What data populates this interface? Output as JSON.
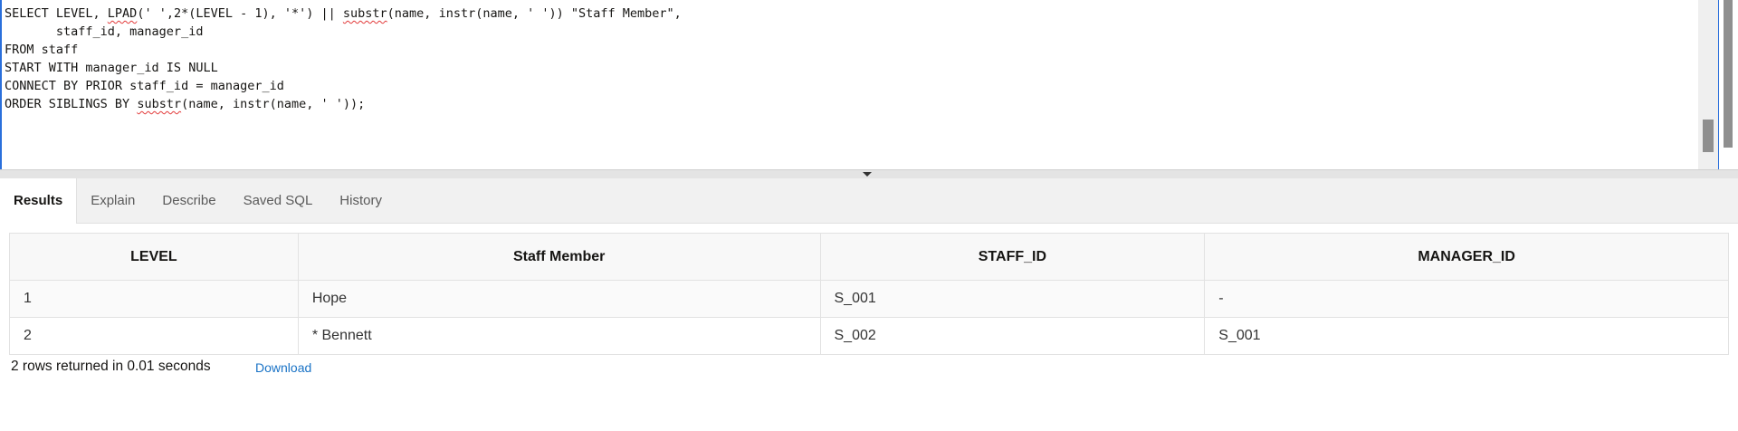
{
  "editor": {
    "lines": [
      [
        "SELECT LEVEL, ",
        {
          "t": "LPAD",
          "err": true
        },
        "(' ',2*(LEVEL - 1), '*') || ",
        {
          "t": "substr",
          "err": true
        },
        "(name, instr(name, ' ')) \"Staff Member\","
      ],
      [
        "       staff_id, manager_id"
      ],
      [
        "FROM staff"
      ],
      [
        "START WITH manager_id IS NULL"
      ],
      [
        "CONNECT BY PRIOR staff_id = manager_id"
      ],
      [
        "ORDER SIBLINGS BY ",
        {
          "t": "substr",
          "err": true
        },
        "(name, instr(name, ' '));"
      ]
    ]
  },
  "tabs": [
    {
      "label": "Results",
      "active": true
    },
    {
      "label": "Explain",
      "active": false
    },
    {
      "label": "Describe",
      "active": false
    },
    {
      "label": "Saved SQL",
      "active": false
    },
    {
      "label": "History",
      "active": false
    }
  ],
  "results": {
    "columns": [
      "LEVEL",
      "Staff Member",
      "STAFF_ID",
      "MANAGER_ID"
    ],
    "rows": [
      [
        "1",
        "Hope",
        "S_001",
        "-"
      ],
      [
        "2",
        "* Bennett",
        "S_002",
        "S_001"
      ]
    ]
  },
  "footer": {
    "status": "2 rows returned in 0.01 seconds",
    "download_label": "Download"
  },
  "colors": {
    "accent": "#2a6fdb",
    "link": "#1a73c6",
    "error_underline": "#e23a3a"
  }
}
